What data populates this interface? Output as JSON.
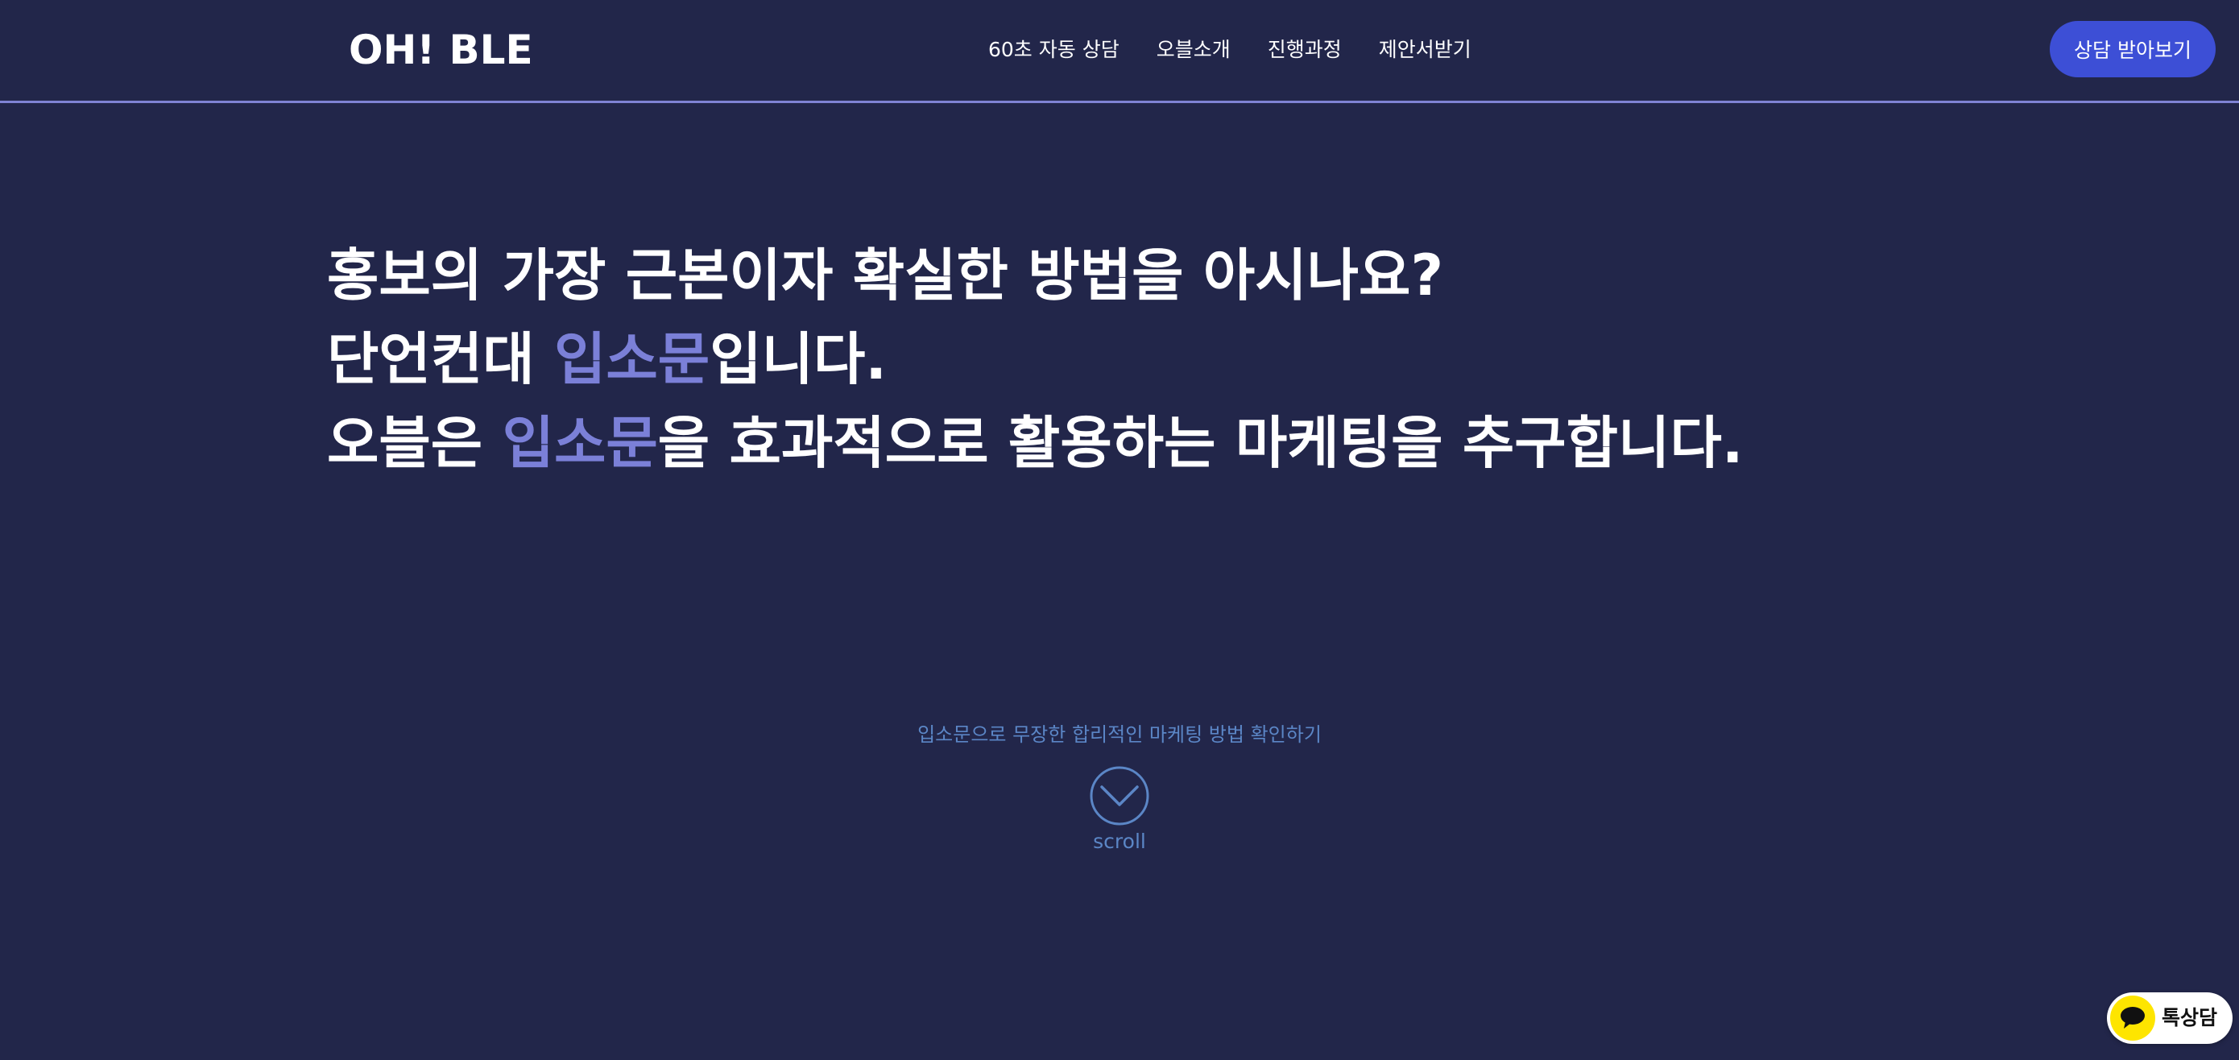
{
  "header": {
    "logo": "OH! BLE",
    "nav": [
      {
        "label": "60초 자동 상담"
      },
      {
        "label": "오블소개"
      },
      {
        "label": "진행과정"
      },
      {
        "label": "제안서받기"
      }
    ],
    "cta_label": "상담 받아보기"
  },
  "hero": {
    "line1": "홍보의 가장 근본이자 확실한 방법을 아시나요?",
    "line2_prefix": "단언컨대 ",
    "line2_accent": "입소문",
    "line2_suffix": "입니다.",
    "line3_prefix": "오블은 ",
    "line3_accent": "입소문",
    "line3_suffix": "을 효과적으로 활용하는 마케팅을 추구합니다."
  },
  "scroll": {
    "caption": "입소문으로 무장한 합리적인 마케팅 방법 확인하기",
    "icon": "chevron-down-circle-icon",
    "label": "scroll"
  },
  "kakao": {
    "icon": "speech-bubble-icon",
    "label": "톡상담"
  },
  "colors": {
    "background": "#22264a",
    "accent": "#7b80d8",
    "button": "#3d4fd6",
    "scroll_text": "#5b86c6",
    "kakao_yellow": "#fee500"
  }
}
